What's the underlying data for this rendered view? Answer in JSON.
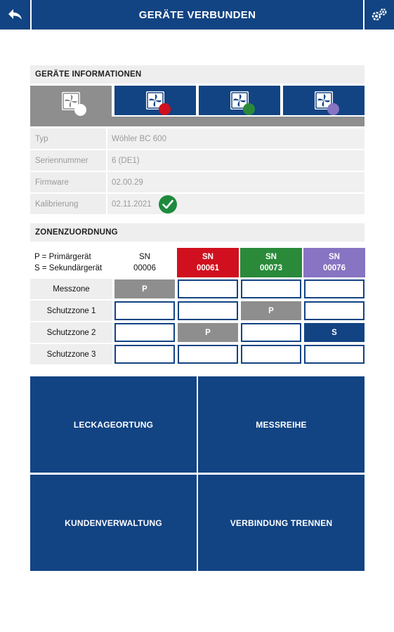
{
  "header": {
    "title": "GERÄTE VERBUNDEN",
    "back_icon": "back-arrow-icon",
    "settings_icon": "gears-icon"
  },
  "device_info": {
    "section_title": "GERÄTE INFORMATIONEN",
    "tabs": [
      {
        "icon": "fan-device-icon",
        "dot_color": "#ffffff",
        "active": true
      },
      {
        "icon": "fan-device-icon",
        "dot_color": "#d0101e",
        "active": false
      },
      {
        "icon": "fan-device-icon",
        "dot_color": "#2a8a3a",
        "active": false
      },
      {
        "icon": "fan-device-icon",
        "dot_color": "#8774c2",
        "active": false
      }
    ],
    "rows": [
      {
        "label": "Typ",
        "value": "Wöhler BC 600"
      },
      {
        "label": "Seriennummer",
        "value": "6 (DE1)"
      },
      {
        "label": "Firmware",
        "value": "02.00.29"
      },
      {
        "label": "Kalibrierung",
        "value": "02.11.2021"
      }
    ],
    "calibration_status_icon": "check-circle-icon"
  },
  "zones": {
    "section_title": "ZONENZUORDNUNG",
    "legend_line1": "P = Primärgerät",
    "legend_line2": "S = Sekundärgerät",
    "devices": [
      {
        "sn_label": "SN",
        "sn": "00006",
        "color": "#ffffff"
      },
      {
        "sn_label": "SN",
        "sn": "00061",
        "color": "#d0101e"
      },
      {
        "sn_label": "SN",
        "sn": "00073",
        "color": "#2a8a3a"
      },
      {
        "sn_label": "SN",
        "sn": "00076",
        "color": "#8774c2"
      }
    ],
    "rows": [
      {
        "label": "Messzone",
        "cells": [
          "P",
          "",
          "",
          ""
        ]
      },
      {
        "label": "Schutzzone 1",
        "cells": [
          "",
          "",
          "P",
          ""
        ]
      },
      {
        "label": "Schutzzone 2",
        "cells": [
          "",
          "P",
          "",
          "S"
        ]
      },
      {
        "label": "Schutzzone 3",
        "cells": [
          "",
          "",
          "",
          ""
        ]
      }
    ]
  },
  "actions": {
    "leak_detection": "LECKAGEORTUNG",
    "measurement_series": "MESSREIHE",
    "customer_management": "KUNDENVERWALTUNG",
    "disconnect": "VERBINDUNG TRENNEN"
  },
  "colors": {
    "primary_blue": "#124383",
    "grey": "#8e8e8e",
    "success_green": "#1e8a3e"
  }
}
